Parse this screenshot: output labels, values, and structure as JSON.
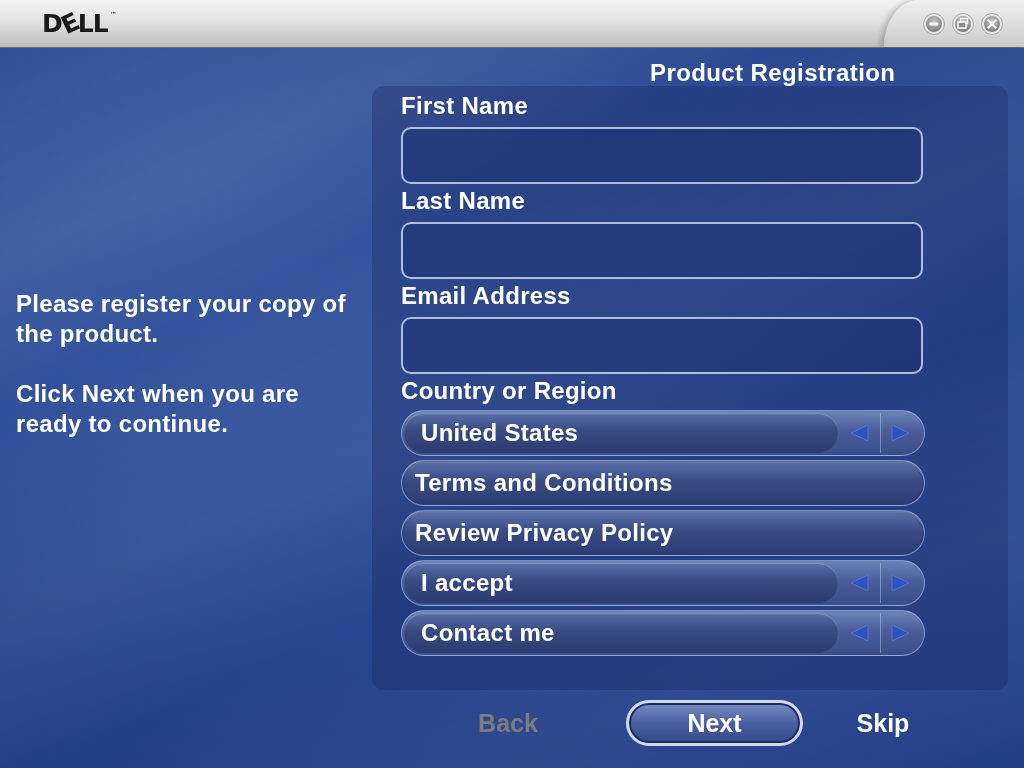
{
  "window": {
    "logo": "DELL",
    "trademark": "™"
  },
  "title": "Product Registration",
  "instructions": [
    "Please register your copy of the product.",
    "Click Next when you are ready to continue."
  ],
  "fields": [
    {
      "label": "First Name"
    },
    {
      "label": "Last Name"
    },
    {
      "label": "Email Address"
    }
  ],
  "country": {
    "label": "Country or Region"
  },
  "options": [
    {
      "kind": "spinner",
      "label": "United States"
    },
    {
      "kind": "link",
      "label": "Terms and Conditions"
    },
    {
      "kind": "link",
      "label": "Review Privacy Policy"
    },
    {
      "kind": "spinner",
      "label": "I accept"
    },
    {
      "kind": "spinner",
      "label": "Contact me"
    }
  ],
  "buttons": [
    {
      "kind": "text",
      "label": "Back",
      "disabled": true
    },
    {
      "kind": "pill",
      "label": "Next",
      "disabled": false
    },
    {
      "kind": "text",
      "label": "Skip",
      "disabled": false
    }
  ]
}
